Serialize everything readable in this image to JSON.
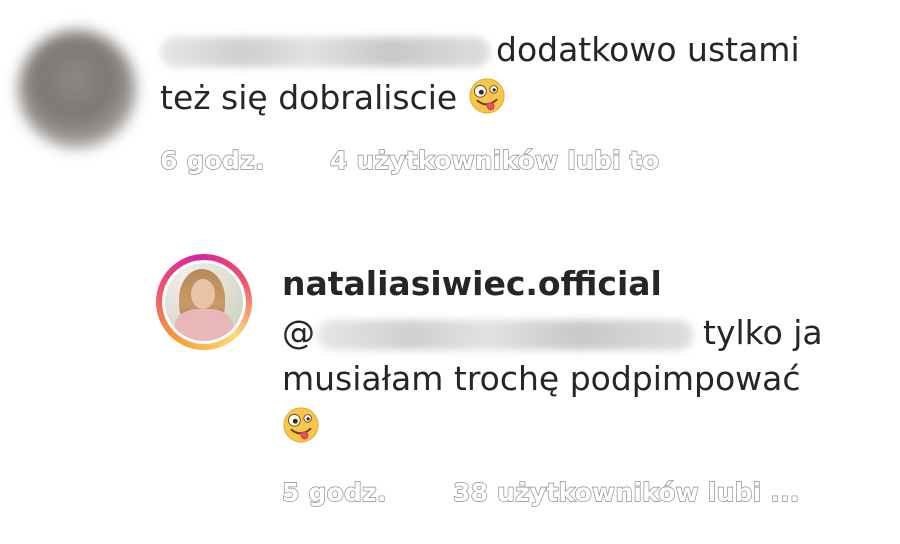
{
  "comment_1": {
    "text_line_1": "dodatkowo ustami",
    "text_line_2": "też się dobraliscie",
    "emoji_icon": "zany-face-emoji",
    "time": "6 godz.",
    "likes": "4 użytkowników lubi to"
  },
  "comment_2": {
    "username": "nataliasiwiec.official",
    "mention_prefix": "@",
    "text_line_1": "tylko ja",
    "text_line_2": "musiałam trochę podpimpować",
    "emoji_icon": "zany-face-emoji",
    "time": "5 godz.",
    "likes": "38 użytkowników lubi ...",
    "avatar_ring_colors": [
      "#f9a13a",
      "#f0586e",
      "#d6249f",
      "#feda75"
    ]
  },
  "colors": {
    "text": "#262626",
    "meta_outline": "#8e8e8e",
    "background": "#ffffff"
  }
}
